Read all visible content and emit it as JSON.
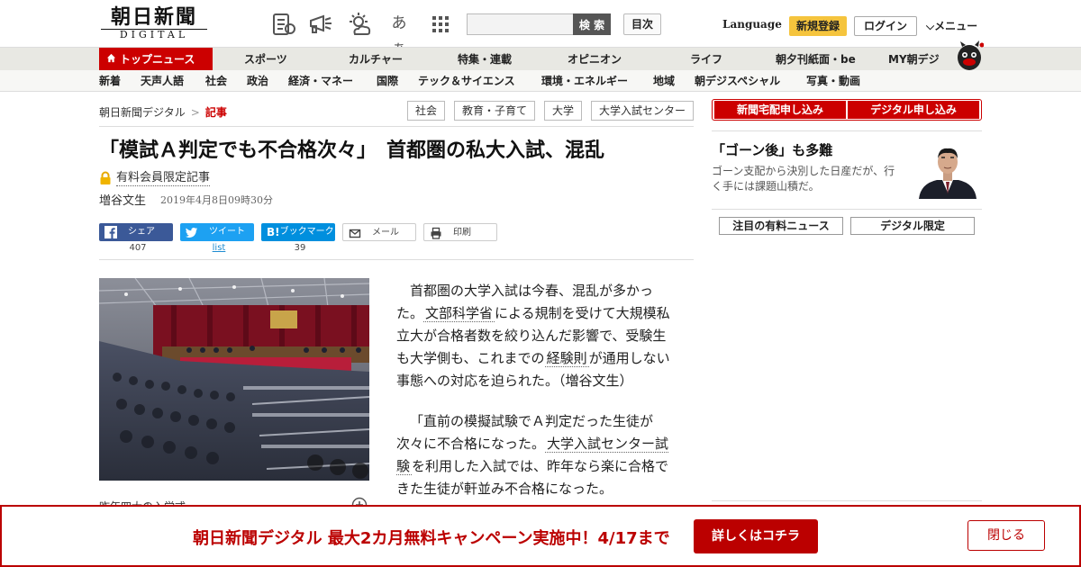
{
  "header": {
    "logo_main": "朝日新聞",
    "logo_sub": "DIGITAL",
    "aa_label": "あぁ",
    "search_placeholder": "",
    "search_button": "検 索",
    "toc_button": "目次",
    "language": "Language",
    "register": "新規登録",
    "login": "ログイン",
    "menu": "メニュー"
  },
  "main_nav": {
    "top_news": "トップニュース",
    "items": [
      "スポーツ",
      "カルチャー",
      "特集・連載",
      "オピニオン",
      "ライフ",
      "朝夕刊紙面・be",
      "MY朝デジ"
    ]
  },
  "sub_nav": {
    "items": [
      "新着",
      "天声人語",
      "社会",
      "政治",
      "経済・マネー",
      "国際",
      "テック＆サイエンス",
      "環境・エネルギー",
      "地域",
      "朝デジスペシャル",
      "写真・動画"
    ]
  },
  "breadcrumb": {
    "home": "朝日新聞デジタル",
    "separator": ">",
    "current": "記事"
  },
  "tags": [
    "社会",
    "教育・子育て",
    "大学",
    "大学入試センター"
  ],
  "article": {
    "title": "「模試Ａ判定でも不合格次々」　首都圏の私大入試、混乱",
    "member_label": "有料会員限定記事",
    "author": "増谷文生",
    "date": "2019年4月8日09時30分",
    "share": {
      "facebook": "シェア",
      "facebook_count": "407",
      "twitter": "ツイート",
      "twitter_count": "list",
      "hatena": "ブックマーク",
      "hatena_count": "39",
      "mail": "メール",
      "print": "印刷"
    },
    "photo_caption": "昨年四大の入学式",
    "paragraph1": {
      "a": "首都圏の大学入試は今春、混乱が多かった。",
      "kw1": "文部科学省",
      "b": "による規制を受けて大規模私立大が合格者数を絞り込んだ影響で、受験生も大学側も、これまでの",
      "kw2": "経験則",
      "c": "が通用しない事態への対応を迫られた。（増谷文生）"
    },
    "paragraph2": {
      "a": "「直前の模擬試験でＡ判定だった生徒が次々に不合格になった。",
      "kw1": "大学入試センター試験",
      "b": "を利用した入試では、昨年なら楽に合格できた生徒が軒並み不合格になった。"
    }
  },
  "sidebar": {
    "subscribe_paper": "新聞宅配申し込み",
    "subscribe_digital": "デジタル申し込み",
    "feature_title": "「ゴーン後」も多難",
    "feature_desc": "ゴーン支配から決別した日産だが、行く手には課題山積だ。",
    "tab_paid_news": "注目の有料ニュース",
    "tab_digital_only": "デジタル限定"
  },
  "banner": {
    "text": "朝日新聞デジタル 最大2カ月無料キャンペーン実施中！4/17まで",
    "detail_button": "詳しくはコチラ",
    "close_button": "閉じる"
  },
  "colors": {
    "brand_red": "#cc0000",
    "register_yellow": "#f5c43d",
    "facebook": "#3b5998",
    "twitter": "#1da1f2",
    "hatena": "#008fde"
  },
  "icons": [
    "newspaper-icon",
    "megaphone-icon",
    "weather-icon",
    "grid-menu-icon",
    "lock-icon",
    "zoom-icon",
    "house-icon",
    "mascot-icon"
  ]
}
